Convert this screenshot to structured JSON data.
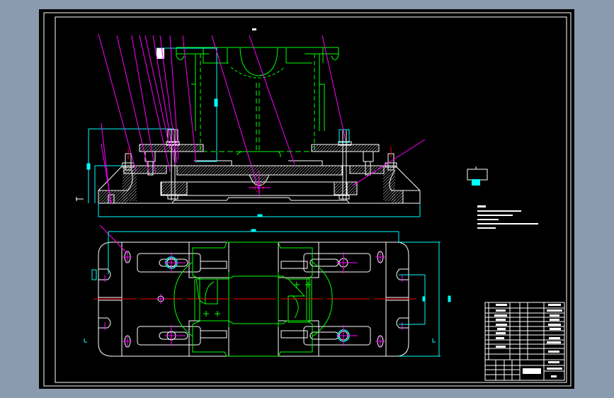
{
  "viewer": {
    "background_color": "#8a9aaf",
    "paper_color": "#000000"
  },
  "drawing": {
    "layer_colors": {
      "outline": "#ffffff",
      "workpiece": "#00ff00",
      "dimension": "#00ffff",
      "leader": "#ff00ff",
      "centerline": "#ff0000"
    }
  }
}
